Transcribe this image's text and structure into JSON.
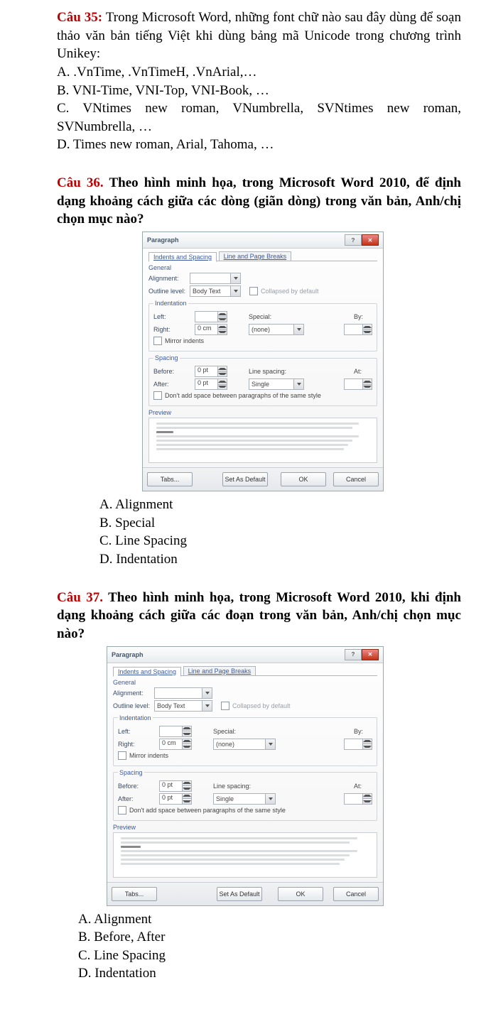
{
  "q35": {
    "header": "Câu 35:",
    "text": " Trong Microsoft Word, những font chữ nào sau đây dùng để soạn thảo văn bản tiếng Việt khi dùng bảng mã Unicode trong chương trình Unikey:",
    "opts": {
      "a": "A. .VnTime, .VnTimeH, .VnArial,…",
      "b": "B. VNI-Time, VNI-Top, VNI-Book, …",
      "c": "C. VNtimes new roman, VNumbrella, SVNtimes new roman, SVNumbrella, …",
      "d": "D. Times new roman, Arial, Tahoma, …"
    }
  },
  "q36": {
    "header": "Câu 36.",
    "text": " Theo hình minh họa, trong Microsoft Word 2010, để định dạng khoảng cách giữa các dòng (giãn dòng) trong văn bản, Anh/chị chọn mục nào?",
    "opts": {
      "a": "A. Alignment",
      "b": "B. Special",
      "c": "C. Line Spacing",
      "d": "D. Indentation"
    }
  },
  "q37": {
    "header": "Câu 37.",
    "text": " Theo hình minh họa, trong Microsoft Word 2010, khi định dạng khoảng cách giữa các đoạn trong văn bản, Anh/chị chọn mục nào?",
    "opts": {
      "a": "A. Alignment",
      "b": "B. Before, After",
      "c": "C. Line Spacing",
      "d": "D. Indentation"
    }
  },
  "dlg": {
    "title": "Paragraph",
    "tab1": "Indents and Spacing",
    "tab2": "Line and Page Breaks",
    "general": "General",
    "alignment": "Alignment:",
    "outline": "Outline level:",
    "bodytext": "Body Text",
    "collapsed": "Collapsed by default",
    "indentation": "Indentation",
    "left": "Left:",
    "right": "Right:",
    "zero_cm": "0 cm",
    "special": "Special:",
    "none": "(none)",
    "by": "By:",
    "mirror": "Mirror indents",
    "spacing": "Spacing",
    "before": "Before:",
    "after": "After:",
    "zero_pt": "0 pt",
    "linespacing": "Line spacing:",
    "single": "Single",
    "at": "At:",
    "dontadd": "Don't add space between paragraphs of the same style",
    "preview": "Preview",
    "tabs": "Tabs...",
    "setdefault": "Set As Default",
    "ok": "OK",
    "cancel": "Cancel"
  }
}
